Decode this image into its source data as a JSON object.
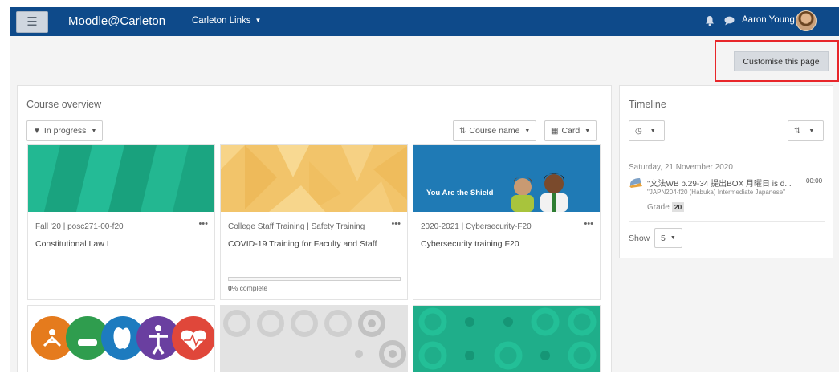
{
  "navbar": {
    "brand": "Moodle@Carleton",
    "links_label": "Carleton Links",
    "user_name": "Aaron Young"
  },
  "page_header": {
    "customise_label": "Customise this page"
  },
  "course_overview": {
    "title": "Course overview",
    "filter_label": "In progress",
    "sort_label": "Course name",
    "view_label": "Card",
    "courses": [
      {
        "category": "Fall '20 | posc271-00-f20",
        "name": "Constitutional Law I"
      },
      {
        "category": "College Staff Training | Safety Training",
        "name": "COVID-19 Training for Faculty and Staff",
        "progress_value": "0",
        "progress_suffix": "% complete"
      },
      {
        "category": "2020-2021 | Cybersecurity-F20",
        "name": "Cybersecurity training F20",
        "banner_text": "You Are the Shield"
      }
    ]
  },
  "timeline": {
    "title": "Timeline",
    "date": "Saturday, 21 November 2020",
    "event_title": "\"文法WB p.29-34 提出BOX 月曜日 is d...",
    "event_time": "00:00",
    "event_course": "\"JAPN204-f20 (Habuka) Intermediate Japanese\"",
    "grade_label": "Grade",
    "grade_value": "20",
    "show_label": "Show",
    "show_value": "5"
  },
  "colors": {
    "navbar": "#0e4a8a",
    "highlight_box": "#e8262a",
    "card_green": "#1fae8a",
    "card_yellow": "#f2c46a",
    "card_blue": "#1f7ab5"
  }
}
